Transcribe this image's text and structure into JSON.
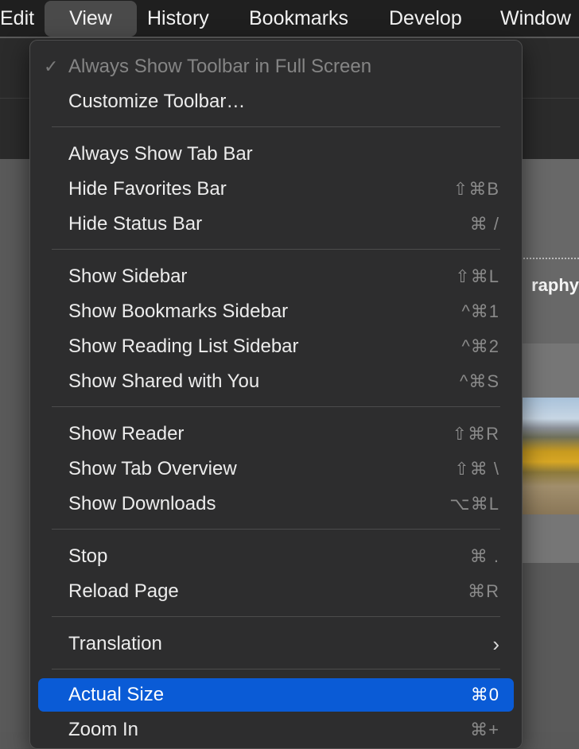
{
  "menubar": {
    "items": [
      "Edit",
      "View",
      "History",
      "Bookmarks",
      "Develop",
      "Window"
    ]
  },
  "background": {
    "heading_fragment": "raphy"
  },
  "menu": {
    "items": [
      {
        "label": "Always Show Toolbar in Full Screen",
        "checked": "✓",
        "state": "disabled"
      },
      {
        "label": "Customize Toolbar…"
      },
      {
        "label": "Always Show Tab Bar"
      },
      {
        "label": "Hide Favorites Bar",
        "shortcut": "⇧⌘B"
      },
      {
        "label": "Hide Status Bar",
        "shortcut": "⌘ /"
      },
      {
        "label": "Show Sidebar",
        "shortcut": "⇧⌘L"
      },
      {
        "label": "Show Bookmarks Sidebar",
        "shortcut": "^⌘1"
      },
      {
        "label": "Show Reading List Sidebar",
        "shortcut": "^⌘2"
      },
      {
        "label": "Show Shared with You",
        "shortcut": "^⌘S"
      },
      {
        "label": "Show Reader",
        "shortcut": "⇧⌘R"
      },
      {
        "label": "Show Tab Overview",
        "shortcut": "⇧⌘ \\"
      },
      {
        "label": "Show Downloads",
        "shortcut": "⌥⌘L"
      },
      {
        "label": "Stop",
        "shortcut": "⌘ ."
      },
      {
        "label": "Reload Page",
        "shortcut": "⌘R"
      },
      {
        "label": "Translation",
        "submenu_icon": "chevron-right-icon"
      },
      {
        "label": "Actual Size",
        "shortcut": "⌘0",
        "state": "highlighted"
      },
      {
        "label": "Zoom In",
        "shortcut": "⌘+"
      }
    ],
    "highlight_color": "#0a5bd6"
  }
}
